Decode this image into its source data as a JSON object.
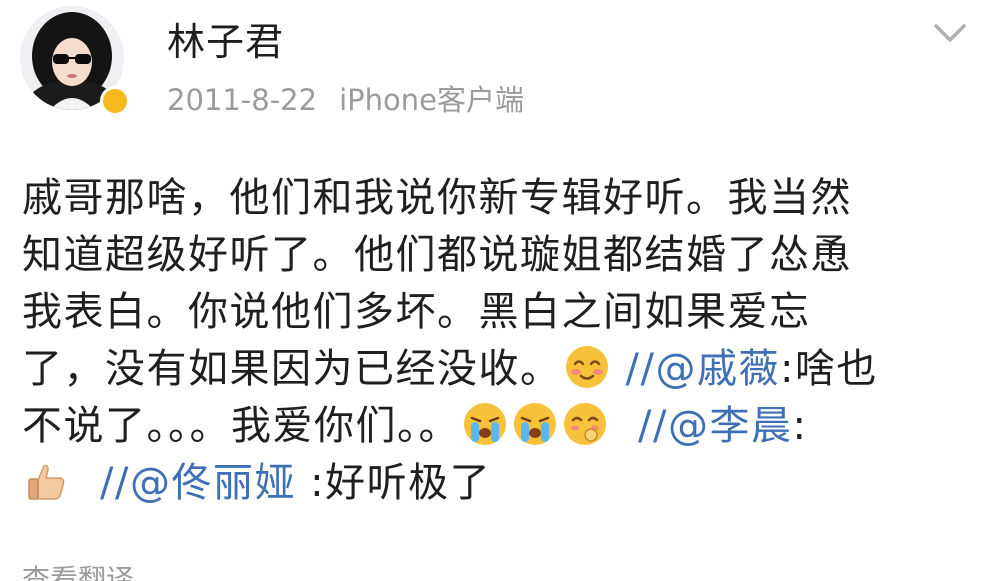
{
  "post": {
    "author": "林子君",
    "date": "2011-8-22",
    "source": "iPhone客户端",
    "body": {
      "l1": "戚哥那啥，他们和我说你新专辑好听。我当然",
      "l2": "知道超级好听了。他们都说璇姐都结婚了怂恿",
      "l3": "我表白。你说他们多坏。黑白之间如果爱忘",
      "l4_text": "了，没有如果因为已经没收。",
      "l4_sep": "//",
      "l4_mention": "@戚薇",
      "l4_tail": ":啥也",
      "l5_text": "不说了。。。我爱你们。。",
      "l5_sep": "//",
      "l5_mention": "@李晨",
      "l5_tail": ":",
      "l6_sep": "//",
      "l6_mention": "@佟丽娅",
      "l6_tail": " :好听极了"
    },
    "translate_label": "查看翻译"
  },
  "icons": {
    "avatar": "avatar-woman-sunglasses",
    "verified": "verified-badge-icon",
    "chevron": "chevron-down-icon",
    "emojis": [
      "blush-emoji",
      "crying-emoji",
      "crying-emoji",
      "shy-emoji",
      "thumbs-up-emoji"
    ]
  },
  "colors": {
    "text": "#1f1f1f",
    "meta": "#9b9b9b",
    "mention": "#3f70b5",
    "badge": "#f6b81c"
  }
}
